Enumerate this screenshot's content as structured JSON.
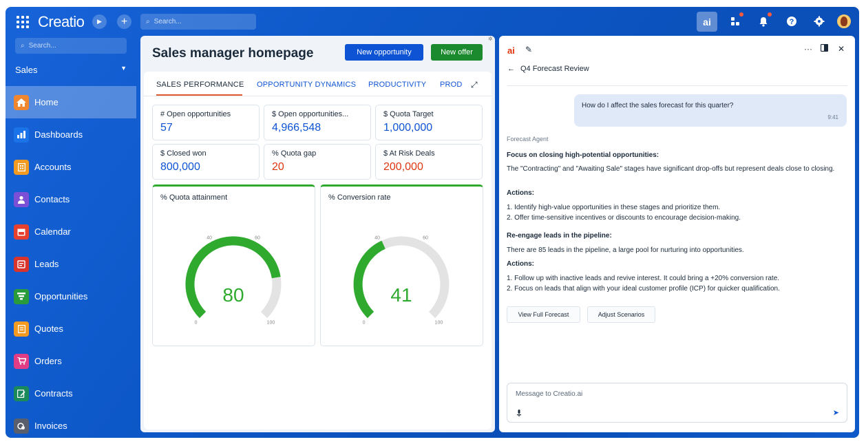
{
  "topbar": {
    "logo": "Creatio",
    "search_placeholder": "Search...",
    "ai_label": "ai"
  },
  "sidebar": {
    "search_placeholder": "Search...",
    "workspace": "Sales",
    "items": [
      {
        "label": "Home",
        "icon": "home-icon",
        "color": "#f0862e"
      },
      {
        "label": "Dashboards",
        "icon": "chart-icon",
        "color": "#1a73e8"
      },
      {
        "label": "Accounts",
        "icon": "building-icon",
        "color": "#f29a22"
      },
      {
        "label": "Contacts",
        "icon": "person-icon",
        "color": "#7b4fd6"
      },
      {
        "label": "Calendar",
        "icon": "calendar-icon",
        "color": "#e8402f"
      },
      {
        "label": "Leads",
        "icon": "leads-icon",
        "color": "#d9342b"
      },
      {
        "label": "Opportunities",
        "icon": "funnel-icon",
        "color": "#2a9b3b"
      },
      {
        "label": "Quotes",
        "icon": "quote-icon",
        "color": "#f29a22"
      },
      {
        "label": "Orders",
        "icon": "cart-icon",
        "color": "#e03d86"
      },
      {
        "label": "Contracts",
        "icon": "contract-icon",
        "color": "#1b8a5a"
      },
      {
        "label": "Invoices",
        "icon": "invoice-icon",
        "color": "#5a5f6e"
      }
    ]
  },
  "main": {
    "title": "Sales manager homepage",
    "new_opportunity": "New opportunity",
    "new_offer": "New offer",
    "tabs": [
      "SALES PERFORMANCE",
      "OPPORTUNITY DYNAMICS",
      "PRODUCTIVITY",
      "PROD"
    ],
    "kpis": [
      {
        "label": "# Open opportunities",
        "value": "57"
      },
      {
        "label": "$ Open opportunities...",
        "value": "4,966,548"
      },
      {
        "label": "$ Quota Target",
        "value": "1,000,000"
      },
      {
        "label": "$ Closed won",
        "value": "800,000"
      },
      {
        "label": "% Quota gap",
        "value": "20"
      },
      {
        "label": "$ At Risk Deals",
        "value": "200,000"
      }
    ],
    "gauges": [
      {
        "title": "% Quota attainment",
        "value": 80,
        "display": "80",
        "t0": "0",
        "t40": "40",
        "t60": "60",
        "t100": "100"
      },
      {
        "title": "% Conversion rate",
        "value": 41,
        "display": "41",
        "t0": "0",
        "t40": "40",
        "t60": "60",
        "t100": "100"
      }
    ]
  },
  "ai": {
    "logo": "ai",
    "more": "···",
    "thread_title": "Q4 Forecast Review",
    "question": "How do I affect the sales forecast for this quarter?",
    "question_time": "9:41",
    "agent": "Forecast Agent",
    "h1": "Focus on closing high-potential opportunities:",
    "p1": "The \"Contracting\" and \"Awaiting Sale\" stages have significant drop-offs but represent deals close to closing.",
    "actions1": "Actions:",
    "a1_1": "1. Identify high-value opportunities in these stages and prioritize them.",
    "a1_2": "2. Offer time-sensitive incentives or discounts to encourage decision-making.",
    "h2": "Re-engage leads in the pipeline:",
    "p2": "There are 85 leads in the pipeline, a large pool for nurturing into opportunities.",
    "actions2": "Actions:",
    "a2_1": "1. Follow up with inactive leads and revive interest. It could bring a +20% conversion rate.",
    "a2_2": "2. Focus on leads that align with your ideal customer profile (ICP) for quicker qualification.",
    "btn_forecast": "View Full Forecast",
    "btn_scenarios": "Adjust Scenarios",
    "message_placeholder": "Message to Creatio.ai"
  }
}
